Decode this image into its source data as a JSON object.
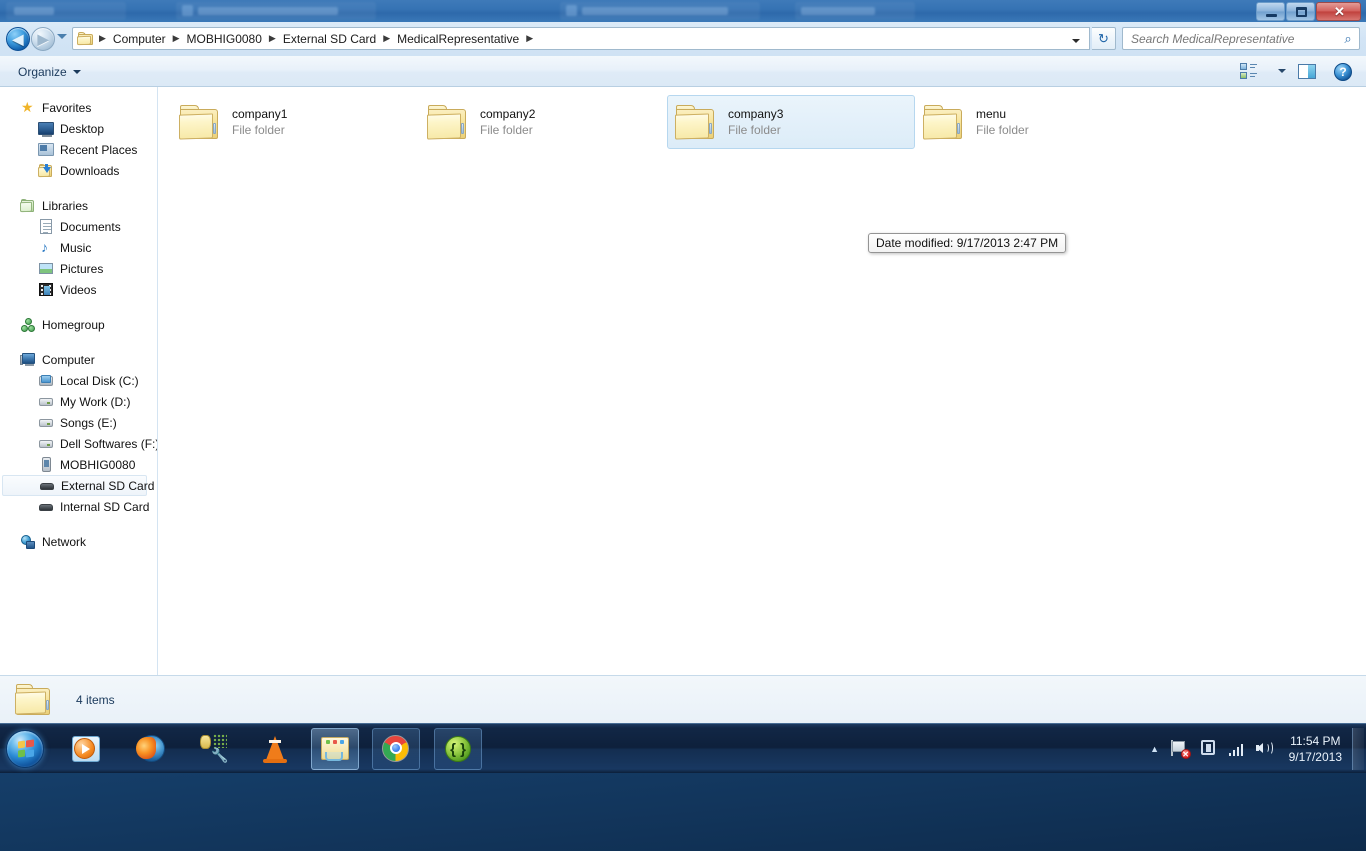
{
  "window": {
    "title_visible": false,
    "controls": {
      "minimize_label": "–",
      "maximize_label": "",
      "close_label": "✕"
    }
  },
  "addressbar": {
    "back_glyph": "◀",
    "forward_glyph": "▶",
    "crumbs": [
      "Computer",
      "MOBHIG0080",
      "External SD Card",
      "MedicalRepresentative"
    ],
    "separator": "▶",
    "refresh_glyph": "↻"
  },
  "search": {
    "placeholder": "Search MedicalRepresentative",
    "value": "",
    "icon_glyph": "⌕"
  },
  "toolbar": {
    "organize_label": "Organize",
    "view_mode_name": "view-mode",
    "preview_pane_name": "preview-pane",
    "help_glyph": "?"
  },
  "navpane": {
    "groups": [
      {
        "header": "Favorites",
        "icon": "star-icon",
        "items": [
          {
            "label": "Desktop",
            "icon": "desktop-icon"
          },
          {
            "label": "Recent Places",
            "icon": "recent-places-icon"
          },
          {
            "label": "Downloads",
            "icon": "downloads-icon"
          }
        ]
      },
      {
        "header": "Libraries",
        "icon": "libraries-icon",
        "items": [
          {
            "label": "Documents",
            "icon": "documents-icon"
          },
          {
            "label": "Music",
            "icon": "music-icon"
          },
          {
            "label": "Pictures",
            "icon": "pictures-icon"
          },
          {
            "label": "Videos",
            "icon": "videos-icon"
          }
        ]
      },
      {
        "header": "Homegroup",
        "icon": "homegroup-icon",
        "items": []
      },
      {
        "header": "Computer",
        "icon": "computer-icon",
        "items": [
          {
            "label": "Local Disk (C:)",
            "icon": "local-disk-icon"
          },
          {
            "label": "My Work (D:)",
            "icon": "drive-icon"
          },
          {
            "label": "Songs (E:)",
            "icon": "drive-icon"
          },
          {
            "label": "Dell Softwares (F:)",
            "icon": "drive-icon"
          },
          {
            "label": "MOBHIG0080",
            "icon": "phone-icon"
          },
          {
            "label": "External SD Card",
            "icon": "sd-card-icon",
            "selected": true,
            "indent": 2
          },
          {
            "label": "Internal SD Card",
            "icon": "sd-card-icon",
            "indent": 2
          }
        ]
      },
      {
        "header": "Network",
        "icon": "network-icon",
        "items": []
      }
    ]
  },
  "content": {
    "items": [
      {
        "name": "company1",
        "type": "File folder",
        "selected": false
      },
      {
        "name": "company2",
        "type": "File folder",
        "selected": false
      },
      {
        "name": "company3",
        "type": "File folder",
        "selected": true
      },
      {
        "name": "menu",
        "type": "File folder",
        "selected": false
      }
    ]
  },
  "tooltip": {
    "text": "Date modified: 9/17/2013 2:47 PM"
  },
  "statusbar": {
    "item_count": "4 items"
  },
  "taskbar": {
    "start_name": "start-orb",
    "apps": [
      {
        "name": "windows-media-player",
        "state": "pinned"
      },
      {
        "name": "firefox",
        "state": "pinned"
      },
      {
        "name": "database-tools",
        "state": "pinned"
      },
      {
        "name": "vlc-media-player",
        "state": "pinned"
      },
      {
        "name": "windows-explorer",
        "state": "active"
      },
      {
        "name": "google-chrome",
        "state": "running"
      },
      {
        "name": "code-editor",
        "state": "running"
      }
    ],
    "tray": {
      "expand_glyph": "▲",
      "icons": [
        {
          "name": "action-center-flag-icon",
          "badge": "✕"
        },
        {
          "name": "safely-remove-hardware-icon"
        },
        {
          "name": "network-signal-icon"
        },
        {
          "name": "volume-icon"
        }
      ]
    },
    "clock": {
      "time": "11:54 PM",
      "date": "9/17/2013"
    }
  },
  "colors": {
    "accent": "#2f6fad",
    "selection": "#dcecf8",
    "folder": "#f6e399",
    "taskbar": "#0d1f3a"
  }
}
